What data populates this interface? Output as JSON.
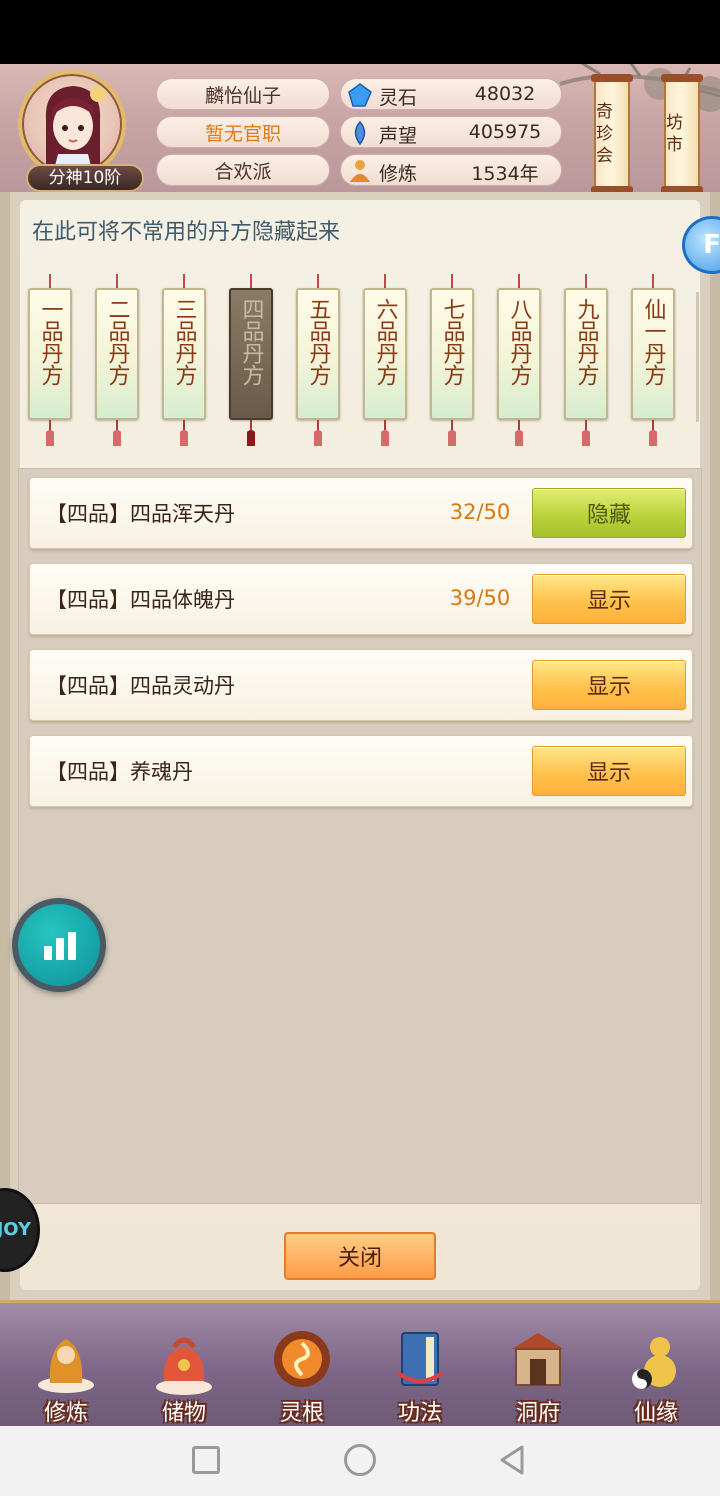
{
  "header": {
    "character_name": "麟怡仙子",
    "official_title": "暂无官职",
    "sect": "合欢派",
    "rank": "分神10阶",
    "resources": [
      {
        "icon": "spirit-stone-icon",
        "label": "灵石",
        "value": "48032"
      },
      {
        "icon": "reputation-icon",
        "label": "声望",
        "value": "405975"
      },
      {
        "icon": "cultivation-icon",
        "label": "修炼",
        "value": "1534年"
      }
    ],
    "shop_buttons": [
      "奇珍会",
      "坊市"
    ]
  },
  "panel": {
    "hint": "在此可将不常用的丹方隐藏起来",
    "tabs": [
      {
        "label": "一品丹方",
        "active": false
      },
      {
        "label": "二品丹方",
        "active": false
      },
      {
        "label": "三品丹方",
        "active": false
      },
      {
        "label": "四品丹方",
        "active": true
      },
      {
        "label": "五品丹方",
        "active": false
      },
      {
        "label": "六品丹方",
        "active": false
      },
      {
        "label": "七品丹方",
        "active": false
      },
      {
        "label": "八品丹方",
        "active": false
      },
      {
        "label": "九品丹方",
        "active": false
      },
      {
        "label": "仙一丹方",
        "active": false
      }
    ],
    "recipes": [
      {
        "name": "【四品】四品浑天丹",
        "count": "32/50",
        "action": "隐藏"
      },
      {
        "name": "【四品】四品体魄丹",
        "count": "39/50",
        "action": "显示"
      },
      {
        "name": "【四品】四品灵动丹",
        "count": "",
        "action": "显示"
      },
      {
        "name": "【四品】养魂丹",
        "count": "",
        "action": "显示"
      }
    ],
    "close_label": "关闭"
  },
  "floating": {
    "joy_label": "JOY"
  },
  "bottom_nav": [
    {
      "label": "修炼",
      "icon": "monk-icon"
    },
    {
      "label": "储物",
      "icon": "bag-icon"
    },
    {
      "label": "灵根",
      "icon": "spirit-root-icon"
    },
    {
      "label": "功法",
      "icon": "book-icon"
    },
    {
      "label": "洞府",
      "icon": "cave-house-icon"
    },
    {
      "label": "仙缘",
      "icon": "gourd-icon"
    }
  ],
  "colors": {
    "title_orange": "#e07a14",
    "count_orange": "#d9780f",
    "hide_button": "#bcd23b",
    "show_button": "#ffc24d"
  }
}
